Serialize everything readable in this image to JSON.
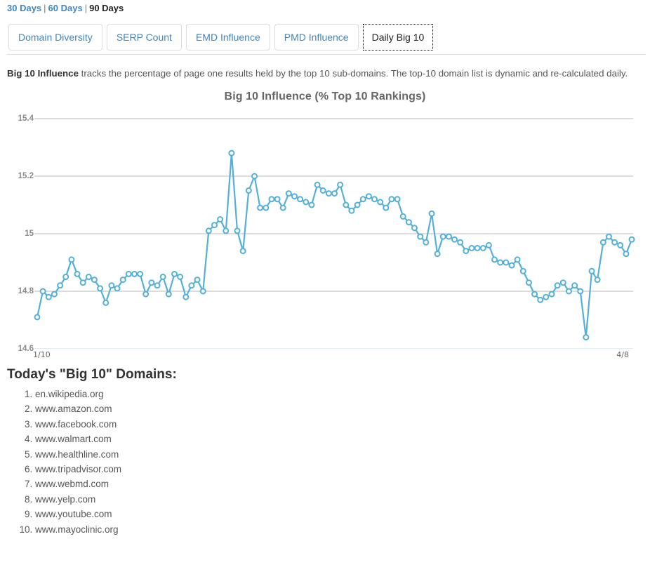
{
  "range_bar": {
    "items": [
      {
        "label": "30 Days",
        "active": false
      },
      {
        "label": "60 Days",
        "active": false
      },
      {
        "label": "90 Days",
        "active": true
      }
    ],
    "separator": "|"
  },
  "tabs": [
    {
      "label": "Domain Diversity",
      "active": false
    },
    {
      "label": "SERP Count",
      "active": false
    },
    {
      "label": "EMD Influence",
      "active": false
    },
    {
      "label": "PMD Influence",
      "active": false
    },
    {
      "label": "Daily Big 10",
      "active": true
    }
  ],
  "description": {
    "lead": "Big 10 Influence",
    "rest": " tracks the percentage of page one results held by the top 10 sub-domains. The top-10 domain list is dynamic and re-calculated daily."
  },
  "domains_section": {
    "title": "Today's \"Big 10\" Domains:",
    "items": [
      "en.wikipedia.org",
      "www.amazon.com",
      "www.facebook.com",
      "www.walmart.com",
      "www.healthline.com",
      "www.tripadvisor.com",
      "www.webmd.com",
      "www.yelp.com",
      "www.youtube.com",
      "www.mayoclinic.org"
    ]
  },
  "colors": {
    "link": "#3d87c4",
    "line": "#54b0d8",
    "marker_fill": "#ffffff",
    "grid": "#b8b8b8",
    "title": "#666666"
  },
  "chart_data": {
    "type": "line",
    "title": "Big 10 Influence (% Top 10 Rankings)",
    "xlabel": "",
    "ylabel": "",
    "ylim": [
      14.6,
      15.4
    ],
    "yticks": [
      15.4,
      15.2,
      15,
      14.8,
      14.6
    ],
    "ytick_labels": [
      "15.4",
      "15.2",
      "15",
      "14.8",
      "14.6"
    ],
    "xtick_labels": [
      "1/10",
      "4/8"
    ],
    "x_start": "1/10",
    "x_end": "4/8",
    "grid": true,
    "legend": "none",
    "markers": "open-circle",
    "series": [
      {
        "name": "Big 10 Influence",
        "values": [
          14.71,
          14.8,
          14.78,
          14.79,
          14.82,
          14.85,
          14.91,
          14.86,
          14.83,
          14.85,
          14.84,
          14.81,
          14.76,
          14.82,
          14.81,
          14.84,
          14.86,
          14.86,
          14.86,
          14.79,
          14.83,
          14.82,
          14.85,
          14.79,
          14.86,
          14.85,
          14.78,
          14.82,
          14.84,
          14.8,
          15.01,
          15.03,
          15.05,
          15.01,
          15.28,
          15.01,
          14.94,
          15.15,
          15.2,
          15.09,
          15.09,
          15.12,
          15.12,
          15.09,
          15.14,
          15.13,
          15.12,
          15.11,
          15.1,
          15.17,
          15.15,
          15.14,
          15.14,
          15.17,
          15.1,
          15.08,
          15.1,
          15.12,
          15.13,
          15.12,
          15.11,
          15.09,
          15.12,
          15.12,
          15.06,
          15.04,
          15.02,
          14.99,
          14.97,
          15.07,
          14.93,
          14.99,
          14.99,
          14.98,
          14.97,
          14.94,
          14.95,
          14.95,
          14.95,
          14.96,
          14.91,
          14.9,
          14.9,
          14.89,
          14.91,
          14.87,
          14.83,
          14.79,
          14.77,
          14.78,
          14.79,
          14.82,
          14.83,
          14.8,
          14.82,
          14.8,
          14.64,
          14.87,
          14.84,
          14.97,
          14.99,
          14.97,
          14.96,
          14.93,
          14.98
        ]
      }
    ]
  }
}
